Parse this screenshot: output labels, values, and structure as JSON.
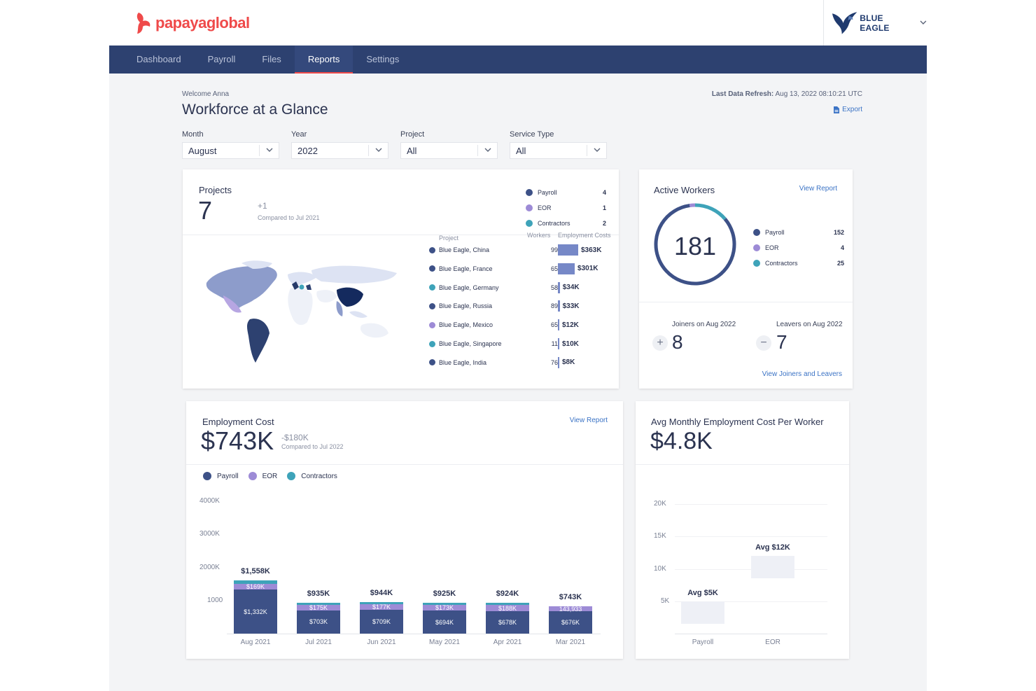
{
  "brand": {
    "name_a": "papaya",
    "name_b": "global",
    "color": "#ef4a4a"
  },
  "company": {
    "name": "BLUE EAGLE"
  },
  "nav": {
    "items": [
      "Dashboard",
      "Payroll",
      "Files",
      "Reports",
      "Settings"
    ],
    "active": "Reports"
  },
  "header": {
    "welcome": "Welcome Anna",
    "title": "Workforce at a Glance",
    "refresh_label": "Last Data Refresh:",
    "refresh_value": "Aug 13, 2022  08:10:21 UTC",
    "export_label": "Export"
  },
  "filters": [
    {
      "label": "Month",
      "value": "August"
    },
    {
      "label": "Year",
      "value": "2022"
    },
    {
      "label": "Project",
      "value": "All"
    },
    {
      "label": "Service Type",
      "value": "All"
    }
  ],
  "projects_card": {
    "title": "Projects",
    "value": "7",
    "delta": "+1",
    "compare": "Compared to Jul 2021",
    "legend": [
      {
        "name": "Payroll",
        "value": "4"
      },
      {
        "name": "EOR",
        "value": "1"
      },
      {
        "name": "Contractors",
        "value": "2"
      }
    ],
    "col_project": "Project",
    "col_workers": "Workers",
    "col_costs": "Employment Costs",
    "rows": [
      {
        "name": "Blue Eagle, China",
        "type": "payroll",
        "workers": "99",
        "cost": "$363K",
        "cost_value": 363
      },
      {
        "name": "Blue Eagle, France",
        "type": "payroll",
        "workers": "65",
        "cost": "$301K",
        "cost_value": 301
      },
      {
        "name": "Blue Eagle, Germany",
        "type": "contractors",
        "workers": "58",
        "cost": "$34K",
        "cost_value": 34
      },
      {
        "name": "Blue Eagle, Russia",
        "type": "payroll",
        "workers": "89",
        "cost": "$33K",
        "cost_value": 33
      },
      {
        "name": "Blue Eagle, Mexico",
        "type": "eor",
        "workers": "65",
        "cost": "$12K",
        "cost_value": 12
      },
      {
        "name": "Blue Eagle, Singapore",
        "type": "contractors",
        "workers": "11",
        "cost": "$10K",
        "cost_value": 10
      },
      {
        "name": "Blue Eagle, India",
        "type": "payroll",
        "workers": "76",
        "cost": "$8K",
        "cost_value": 8
      }
    ]
  },
  "active_workers": {
    "title": "Active Workers",
    "view_report": "View Report",
    "total": "181",
    "legend": [
      {
        "name": "Payroll",
        "value": "152",
        "n": 152
      },
      {
        "name": "EOR",
        "value": "4",
        "n": 4
      },
      {
        "name": "Contractors",
        "value": "25",
        "n": 25
      }
    ],
    "joiners_label": "Joiners on Aug 2022",
    "joiners_value": "8",
    "leavers_label": "Leavers on Aug 2022",
    "leavers_value": "7",
    "view_joiners": "View Joiners and Leavers"
  },
  "employment_cost": {
    "title": "Employment Cost",
    "view_report": "View Report",
    "value": "$743K",
    "delta": "-$180K",
    "compare": "Compared to Jul 2022",
    "legend": [
      "Payroll",
      "EOR",
      "Contractors"
    ]
  },
  "avg_cost": {
    "title": "Avg Monthly Employment Cost Per Worker",
    "value": "$4.8K"
  },
  "colors": {
    "payroll": "#3d5187",
    "eor": "#9d8bd6",
    "contractors": "#3ea3b9",
    "accent": "#ef4a4a",
    "nav": "#2d4170",
    "link": "#3b73c5"
  },
  "chart_data": [
    {
      "type": "bar",
      "stacked": true,
      "categories": [
        "Aug 2021",
        "Jul 2021",
        "Jun 2021",
        "May 2021",
        "Apr 2021",
        "Mar 2021"
      ],
      "totals": [
        "$1,558K",
        "$935K",
        "$944K",
        "$925K",
        "$924K",
        "$743K"
      ],
      "series": [
        {
          "name": "Payroll",
          "values": [
            1332,
            703,
            709,
            694,
            678,
            676
          ],
          "labels": [
            "$1,332K",
            "$703K",
            "$709K",
            "$694K",
            "$678K",
            "$676K"
          ]
        },
        {
          "name": "EOR",
          "values": [
            169,
            175,
            177,
            173,
            188,
            144
          ],
          "labels": [
            "$169K",
            "$175K",
            "$177K",
            "$173K",
            "$188K",
            "143,933"
          ]
        },
        {
          "name": "Contractors",
          "values": [
            100,
            57,
            58,
            58,
            58,
            0
          ]
        }
      ],
      "ylim": [
        0,
        4000
      ],
      "yticks": [
        {
          "value": 4000,
          "label": "4000K"
        },
        {
          "value": 3000,
          "label": "3000K"
        },
        {
          "value": 2000,
          "label": "2000K"
        },
        {
          "value": 1000,
          "label": "1000"
        }
      ],
      "legend": "top-left"
    },
    {
      "type": "bar",
      "categories": [
        "Payroll",
        "EOR"
      ],
      "values": [
        5,
        12
      ],
      "labels": [
        "Avg $5K",
        "Avg $12K"
      ],
      "ylim": [
        0,
        20
      ],
      "yticks": [
        {
          "value": 20,
          "label": "20K"
        },
        {
          "value": 15,
          "label": "15K"
        },
        {
          "value": 10,
          "label": "10K"
        },
        {
          "value": 5,
          "label": "5K"
        }
      ],
      "grid": true
    }
  ]
}
